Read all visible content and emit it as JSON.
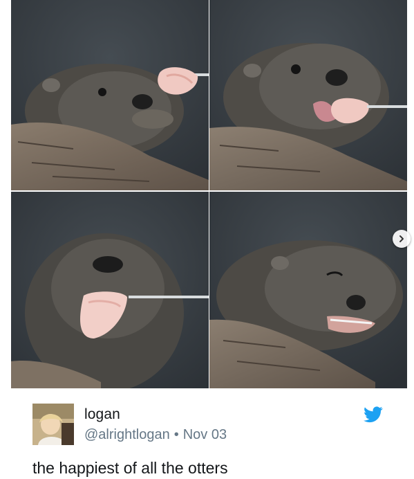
{
  "tweet": {
    "display_name": "logan",
    "handle": "@alrightlogan",
    "separator": "•",
    "date": "Nov 03",
    "text": "the happiest of all the otters"
  },
  "media": {
    "photos": [
      {
        "icon": "otter-photo"
      },
      {
        "icon": "otter-photo"
      },
      {
        "icon": "otter-photo"
      },
      {
        "icon": "otter-photo"
      }
    ],
    "next_icon": "chevron-right-icon"
  },
  "colors": {
    "twitter_blue": "#1da1f2",
    "text": "#14171a",
    "muted": "#657786",
    "background": "#ffffff"
  }
}
